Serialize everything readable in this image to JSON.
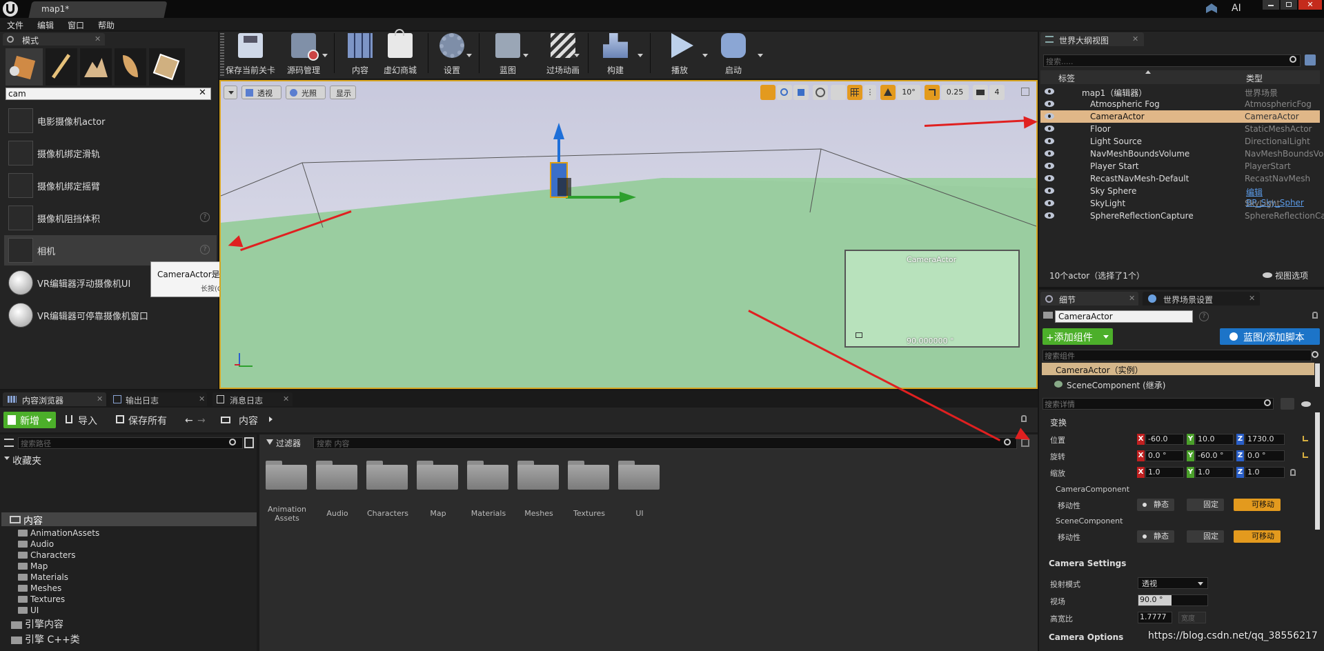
{
  "titlebar": {
    "tab": "map1*",
    "ai": "AI"
  },
  "menu": [
    "文件",
    "编辑",
    "窗口",
    "帮助"
  ],
  "modes": {
    "tab": "模式",
    "search": "cam",
    "items": [
      {
        "label": "电影摄像机actor"
      },
      {
        "label": "摄像机绑定滑轨"
      },
      {
        "label": "摄像机绑定摇臂"
      },
      {
        "label": "摄像机阻挡体积"
      },
      {
        "label": "相机"
      },
      {
        "label": "VR编辑器浮动摄像机UI"
      },
      {
        "label": "VR编辑器可停靠摄像机窗口"
      }
    ]
  },
  "tooltip": {
    "line1": "CameraActor是能够被放置在关卡中的相机视点。",
    "line2": "长按(Ctrl + Alt)获得更多信息"
  },
  "toolbar": [
    "保存当前关卡",
    "源码管理",
    "内容",
    "虚幻商城",
    "设置",
    "蓝图",
    "过场动画",
    "构建",
    "播放",
    "启动"
  ],
  "viewport": {
    "perspective": "透视",
    "lit": "光照",
    "show": "显示",
    "rot_snap": "10°",
    "scale_snap": "0.25",
    "cam_speed": "4",
    "preview_title": "CameraActor",
    "preview_fov": "90.000000 °"
  },
  "outliner": {
    "tab": "世界大纲视图",
    "search_placeholder": "搜索.....",
    "col_label": "标签",
    "col_type": "类型",
    "rows": [
      {
        "name": "map1（编辑器）",
        "type": "世界场景"
      },
      {
        "name": "Atmospheric Fog",
        "type": "AtmosphericFog"
      },
      {
        "name": "CameraActor",
        "type": "CameraActor"
      },
      {
        "name": "Floor",
        "type": "StaticMeshActor"
      },
      {
        "name": "Light Source",
        "type": "DirectionalLight"
      },
      {
        "name": "NavMeshBoundsVolume",
        "type": "NavMeshBoundsVol"
      },
      {
        "name": "Player Start",
        "type": "PlayerStart"
      },
      {
        "name": "RecastNavMesh-Default",
        "type": "RecastNavMesh"
      },
      {
        "name": "Sky Sphere",
        "type": "编辑BP_Sky_Spher"
      },
      {
        "name": "SkyLight",
        "type": "SkyLight"
      },
      {
        "name": "SphereReflectionCapture",
        "type": "SphereReflectionCap"
      }
    ],
    "footer": "10个actor（选择了1个）",
    "view_options": "视图选项"
  },
  "details": {
    "tab": "细节",
    "tab2": "世界场景设置",
    "name": "CameraActor",
    "add_component": "+添加组件",
    "blueprint": "蓝图/添加脚本",
    "search_components": "搜索组件",
    "instance": "CameraActor（实例）",
    "scene_component": "SceneComponent (继承)",
    "search_details": "搜索详情",
    "transform": "变换",
    "location": "位置",
    "rotation": "旋转",
    "scale": "缩放",
    "loc": [
      "-60.0",
      "10.0",
      "1730.0"
    ],
    "rot": [
      "0.0 °",
      "-60.0 °",
      "0.0 °"
    ],
    "scl": [
      "1.0",
      "1.0",
      "1.0"
    ],
    "camera_component": "CameraComponent",
    "mobility": "移动性",
    "static": "静态",
    "stationary": "固定",
    "movable": "可移动",
    "scene_component2": "SceneComponent",
    "camera_settings": "Camera Settings",
    "projection": "投射模式",
    "projection_value": "透视",
    "fov": "视场",
    "fov_value": "90.0 °",
    "aspect": "高宽比",
    "aspect_value": "1.7777",
    "width_hint": "宽度",
    "camera_options": "Camera Options"
  },
  "content": {
    "tabs": [
      "内容浏览器",
      "输出日志",
      "消息日志"
    ],
    "new": "新增",
    "import": "导入",
    "save_all": "保存所有",
    "path": "内容",
    "search_path": "搜索路径",
    "filter": "过滤器",
    "search_content": "搜索 内容",
    "favorites": "收藏夹",
    "root": "内容",
    "tree": [
      "AnimationAssets",
      "Audio",
      "Characters",
      "Map",
      "Materials",
      "Meshes",
      "Textures",
      "UI"
    ],
    "engine_content": "引擎内容",
    "engine_cpp": "引擎 C++类",
    "folders": [
      "Animation Assets",
      "Audio",
      "Characters",
      "Map",
      "Materials",
      "Meshes",
      "Textures",
      "UI"
    ]
  },
  "watermark": "https://blog.csdn.net/qq_38556217"
}
